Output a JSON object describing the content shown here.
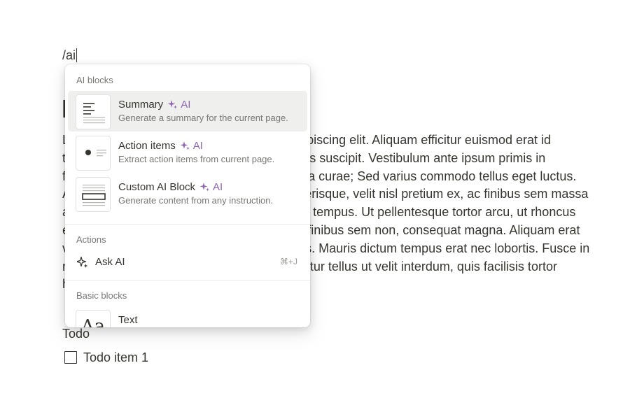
{
  "editor": {
    "command_text": "/ai",
    "paragraph": "Lorem ipsum dolor sit amet, consectetur adipiscing elit. Aliquam efficitur euismod erat id tincidunt. Suspendisse rhoncus tellus ultricies suscipit. Vestibulum ante ipsum primis in faucibus orci luctus et ultrices posuere cubilia curae; Sed varius commodo tellus eget luctus. Aenean vehicula, est vitae ullamcorper scelerisque, velit nisl pretium ex, ac finibus sem massa at nibh. Cras ullamcorper mauris non dictum tempus. Ut pellentesque tortor arcu, ut rhoncus erat dapibus at. Pellentesque in mi gravida, finibus sem non, consequat magna. Aliquam erat volutpat. Donec vel ipsum vel, dictum mauris. Mauris dictum tempus erat nec lobortis. Fusce in nibh vitae mauris sit amet finibus. Nulla efficitur tellus ut velit interdum, quis facilisis tortor hendrerit hendrerit nunc eleifend non.",
    "todo_heading": "Todo",
    "todo_items": [
      {
        "label": "Todo item 1",
        "checked": false
      }
    ]
  },
  "menu": {
    "sections": {
      "ai_blocks": "AI blocks",
      "actions": "Actions",
      "basic_blocks": "Basic blocks"
    },
    "ai_badge": "AI",
    "ai_items": [
      {
        "title": "Summary",
        "description": "Generate a summary for the current page.",
        "icon": "summary-thumbnail"
      },
      {
        "title": "Action items",
        "description": "Extract action items from current page.",
        "icon": "action-items-thumbnail"
      },
      {
        "title": "Custom AI Block",
        "description": "Generate content from any instruction.",
        "icon": "custom-ai-block-thumbnail"
      }
    ],
    "actions": [
      {
        "label": "Ask AI",
        "shortcut": "⌘+J",
        "icon": "sparkle-icon"
      }
    ],
    "basic_items": [
      {
        "title": "Text",
        "thumb_glyph": "Aa",
        "icon": "text-thumbnail"
      }
    ]
  },
  "colors": {
    "text": "#37352f",
    "muted": "#787774",
    "ai_purple": "#9065b0",
    "selected_bg": "#efefee"
  }
}
